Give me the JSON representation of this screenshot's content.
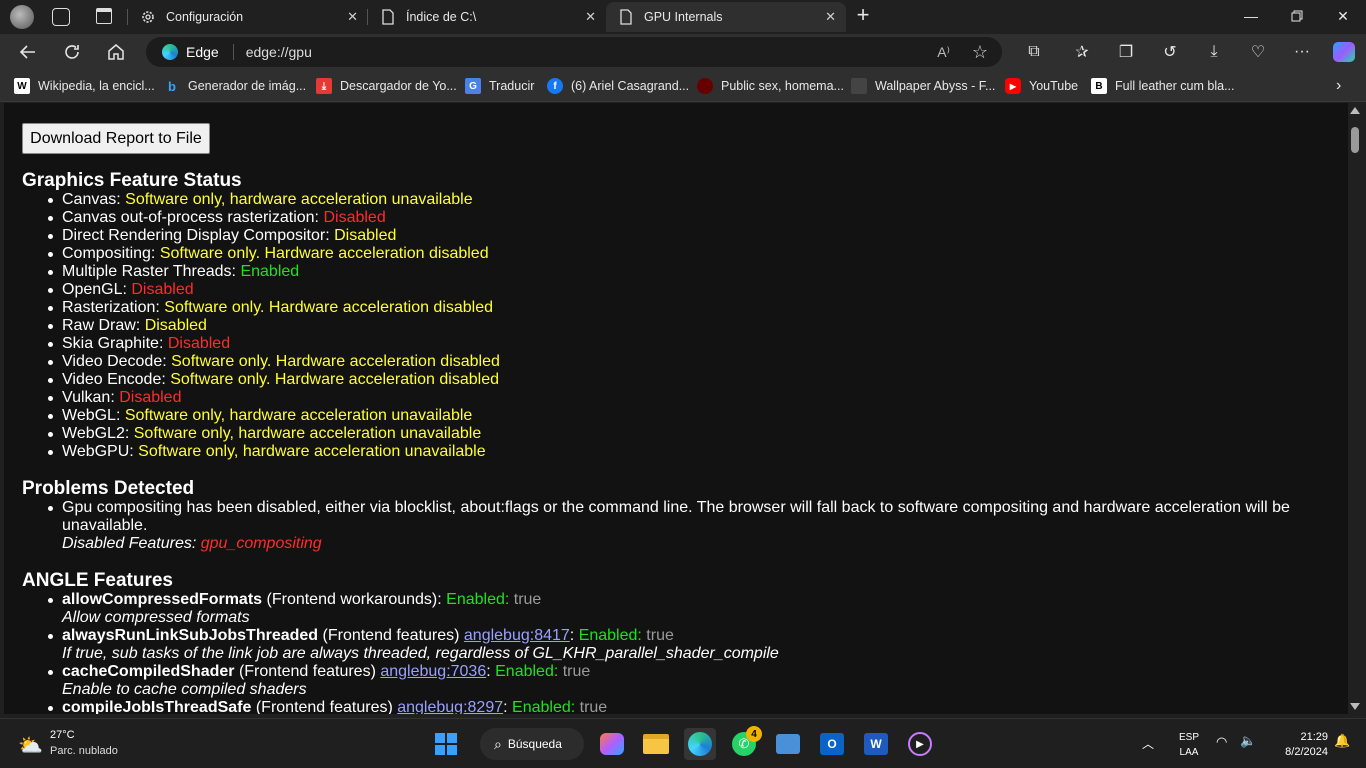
{
  "tabs": [
    {
      "label": "Configuración",
      "icon": "gear-icon"
    },
    {
      "label": "Índice de C:\\",
      "icon": "document-icon"
    },
    {
      "label": "GPU Internals",
      "icon": "document-icon"
    }
  ],
  "address_bar": {
    "brand": "Edge",
    "url": "edge://gpu"
  },
  "bookmarks": [
    {
      "label": "Wikipedia, la encicl...",
      "icon": "wikipedia-icon"
    },
    {
      "label": "Generador de imág...",
      "icon": "bing-icon"
    },
    {
      "label": "Descargador de Yo...",
      "icon": "download-icon"
    },
    {
      "label": "Traducir",
      "icon": "translate-icon"
    },
    {
      "label": "(6) Ariel Casagrand...",
      "icon": "facebook-icon"
    },
    {
      "label": "Public sex, homema...",
      "icon": "site-icon"
    },
    {
      "label": "Wallpaper Abyss - F...",
      "icon": "site-icon"
    },
    {
      "label": "YouTube",
      "icon": "youtube-icon"
    },
    {
      "label": "Full leather cum bla...",
      "icon": "site-icon"
    }
  ],
  "content": {
    "download_button": "Download Report to File",
    "graphics_title": "Graphics Feature Status",
    "features": [
      {
        "name": "Canvas: ",
        "status": "Software only, hardware acceleration unavailable",
        "color": "yel"
      },
      {
        "name": "Canvas out-of-process rasterization: ",
        "status": "Disabled",
        "color": "red"
      },
      {
        "name": "Direct Rendering Display Compositor: ",
        "status": "Disabled",
        "color": "yel"
      },
      {
        "name": "Compositing: ",
        "status": "Software only. Hardware acceleration disabled",
        "color": "yel"
      },
      {
        "name": "Multiple Raster Threads: ",
        "status": "Enabled",
        "color": "grn"
      },
      {
        "name": "OpenGL: ",
        "status": "Disabled",
        "color": "red"
      },
      {
        "name": "Rasterization: ",
        "status": "Software only. Hardware acceleration disabled",
        "color": "yel"
      },
      {
        "name": "Raw Draw: ",
        "status": "Disabled",
        "color": "yel"
      },
      {
        "name": "Skia Graphite: ",
        "status": "Disabled",
        "color": "red"
      },
      {
        "name": "Video Decode: ",
        "status": "Software only. Hardware acceleration disabled",
        "color": "yel"
      },
      {
        "name": "Video Encode: ",
        "status": "Software only. Hardware acceleration disabled",
        "color": "yel"
      },
      {
        "name": "Vulkan: ",
        "status": "Disabled",
        "color": "red"
      },
      {
        "name": "WebGL: ",
        "status": "Software only, hardware acceleration unavailable",
        "color": "yel"
      },
      {
        "name": "WebGL2: ",
        "status": "Software only, hardware acceleration unavailable",
        "color": "yel"
      },
      {
        "name": "WebGPU: ",
        "status": "Software only, hardware acceleration unavailable",
        "color": "yel"
      }
    ],
    "problems_title": "Problems Detected",
    "problem_text": "Gpu compositing has been disabled, either via blocklist, about:flags or the command line. The browser will fall back to software compositing and hardware acceleration will be unavailable.",
    "problem_disabled_label": "Disabled Features: ",
    "problem_disabled_value": "gpu_compositing",
    "angle_title": "ANGLE Features",
    "angle": [
      {
        "name": "allowCompressedFormats",
        "category": " (Frontend workarounds)",
        "bug": "",
        "enabled": "Enabled",
        "value": "true",
        "desc": "Allow compressed formats"
      },
      {
        "name": "alwaysRunLinkSubJobsThreaded",
        "category": " (Frontend features) ",
        "bug": "anglebug:8417",
        "enabled": "Enabled",
        "value": "true",
        "desc": "If true, sub tasks of the link job are always threaded, regardless of GL_KHR_parallel_shader_compile"
      },
      {
        "name": "cacheCompiledShader",
        "category": " (Frontend features) ",
        "bug": "anglebug:7036",
        "enabled": "Enabled",
        "value": "true",
        "desc": "Enable to cache compiled shaders"
      },
      {
        "name": "compileJobIsThreadSafe",
        "category": " (Frontend features) ",
        "bug": "anglebug:8297",
        "enabled": "Enabled",
        "value": "true",
        "desc": ""
      }
    ]
  },
  "taskbar": {
    "weather_temp": "27°C",
    "weather_desc": "Parc. nublado",
    "search_label": "Búsqueda",
    "whatsapp_badge": "4",
    "lang_top": "ESP",
    "lang_bottom": "LAA",
    "time": "21:29",
    "date": "8/2/2024"
  }
}
